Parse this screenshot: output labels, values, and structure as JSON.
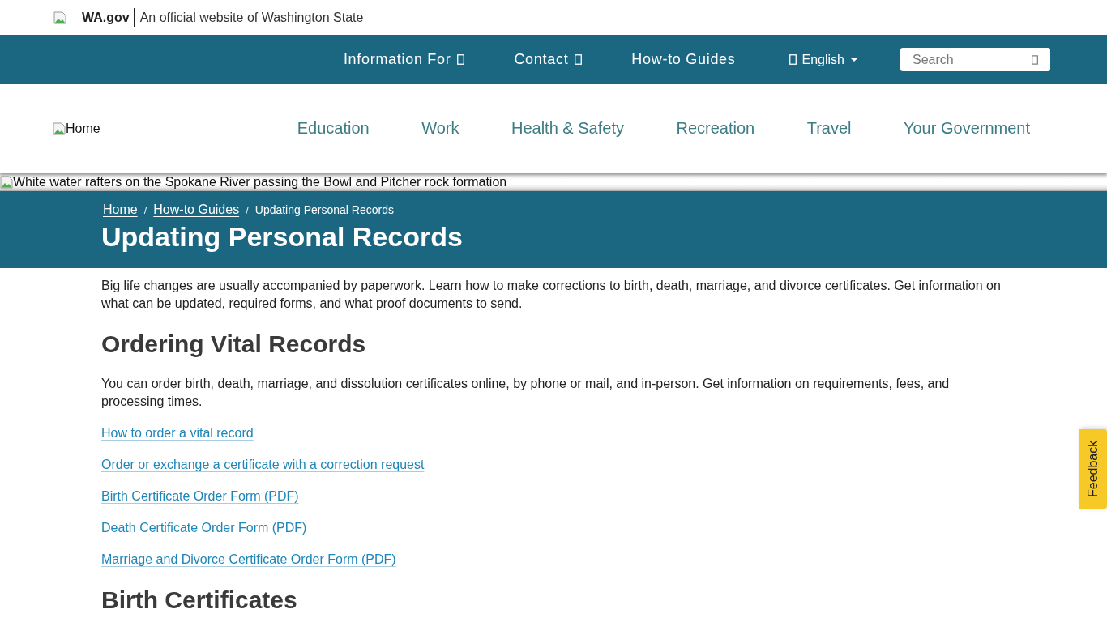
{
  "official_banner": {
    "site": "WA.gov",
    "text": "An official website of Washington State"
  },
  "utility_nav": {
    "items": [
      {
        "label": "Information For",
        "dropdown": true
      },
      {
        "label": "Contact",
        "dropdown": true
      },
      {
        "label": "How-to Guides",
        "dropdown": false
      }
    ],
    "language": {
      "label": "English"
    },
    "search": {
      "placeholder": "Search"
    }
  },
  "header": {
    "logo_alt": "Home",
    "nav": [
      "Education",
      "Work",
      "Health & Safety",
      "Recreation",
      "Travel",
      "Your Government"
    ]
  },
  "hero": {
    "alt": "White water rafters on the Spokane River passing the Bowl and Pitcher rock formation"
  },
  "page_title_band": {
    "breadcrumb": [
      {
        "label": "Home",
        "kind": "link"
      },
      {
        "label": "/",
        "kind": "separator"
      },
      {
        "label": "How-to Guides",
        "kind": "link"
      },
      {
        "label": "/",
        "kind": "separator"
      },
      {
        "label": "Updating Personal Records",
        "kind": "current"
      }
    ],
    "title": "Updating Personal Records"
  },
  "content": [
    {
      "kind": "paragraph",
      "text": "Big life changes are usually accompanied by paperwork. Learn how to make corrections to birth, death, marriage, and divorce certificates. Get information on what can be updated, required forms, and what proof documents to send."
    },
    {
      "kind": "heading",
      "text": "Ordering Vital Records"
    },
    {
      "kind": "paragraph",
      "text": "You can order birth, death, marriage, and dissolution certificates online, by phone or mail, and in-person. Get information on requirements, fees, and processing times."
    },
    {
      "kind": "link",
      "text": "How to order a vital record"
    },
    {
      "kind": "link",
      "text": "Order or exchange a certificate with a correction request"
    },
    {
      "kind": "link",
      "text": "Birth Certificate Order Form (PDF)"
    },
    {
      "kind": "link",
      "text": "Death Certificate Order Form (PDF)"
    },
    {
      "kind": "link",
      "text": "Marriage and Divorce Certificate Order Form (PDF)"
    },
    {
      "kind": "heading",
      "text": "Birth Certificates"
    }
  ],
  "feedback": {
    "label": "Feedback"
  }
}
